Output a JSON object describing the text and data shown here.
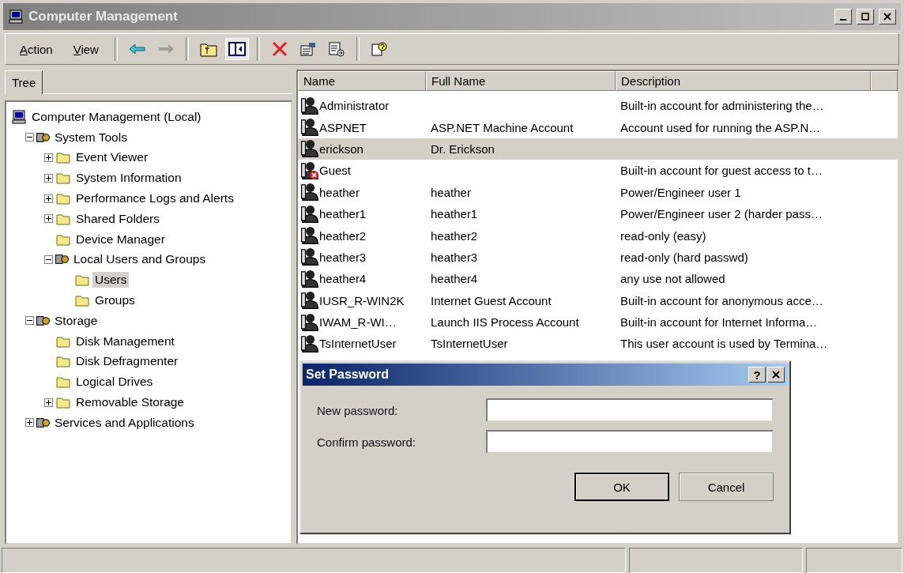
{
  "window": {
    "title": "Computer Management"
  },
  "menu": [
    {
      "label": "Action"
    },
    {
      "label": "View"
    }
  ],
  "tree_tab": {
    "label": "Tree",
    "selected": true
  },
  "tree": [
    {
      "label": "Computer Management (Local)",
      "selected": false,
      "children": [
        {
          "label": "System Tools",
          "selected": false,
          "expanded": true,
          "children": [
            {
              "label": "Event Viewer",
              "selected": false,
              "expanded": false
            },
            {
              "label": "System Information",
              "selected": false,
              "expanded": false
            },
            {
              "label": "Performance Logs and Alerts",
              "selected": false,
              "expanded": false
            },
            {
              "label": "Shared Folders",
              "selected": false,
              "expanded": false
            },
            {
              "label": "Device Manager",
              "selected": false
            },
            {
              "label": "Local Users and Groups",
              "selected": false,
              "expanded": true,
              "children": [
                {
                  "label": "Users",
                  "selected": true
                },
                {
                  "label": "Groups",
                  "selected": false
                }
              ]
            }
          ]
        },
        {
          "label": "Storage",
          "selected": false,
          "expanded": true,
          "children": [
            {
              "label": "Disk Management",
              "selected": false
            },
            {
              "label": "Disk Defragmenter",
              "selected": false
            },
            {
              "label": "Logical Drives",
              "selected": false
            },
            {
              "label": "Removable Storage",
              "selected": false,
              "expanded": false
            }
          ]
        },
        {
          "label": "Services and Applications",
          "selected": false,
          "expanded": false
        }
      ]
    }
  ],
  "table": {
    "columns": [
      "Name",
      "Full Name",
      "Description"
    ],
    "rows": [
      {
        "name": "Administrator",
        "full_name": "",
        "description": "Built-in account for administering the…",
        "selected": false,
        "disabled": false
      },
      {
        "name": "ASPNET",
        "full_name": "ASP.NET Machine Account",
        "description": "Account used for running the ASP.N…",
        "selected": false,
        "disabled": false
      },
      {
        "name": "erickson",
        "full_name": "Dr. Erickson",
        "description": "",
        "selected": true,
        "disabled": false
      },
      {
        "name": "Guest",
        "full_name": "",
        "description": "Built-in account for guest access to t…",
        "selected": false,
        "disabled": true
      },
      {
        "name": "heather",
        "full_name": "heather",
        "description": "Power/Engineer user 1",
        "selected": false,
        "disabled": false
      },
      {
        "name": "heather1",
        "full_name": "heather1",
        "description": "Power/Engineer user 2 (harder pass…",
        "selected": false,
        "disabled": false
      },
      {
        "name": "heather2",
        "full_name": "heather2",
        "description": "read-only (easy)",
        "selected": false,
        "disabled": false
      },
      {
        "name": "heather3",
        "full_name": "heather3",
        "description": "read-only (hard passwd)",
        "selected": false,
        "disabled": false
      },
      {
        "name": "heather4",
        "full_name": "heather4",
        "description": "any use not allowed",
        "selected": false,
        "disabled": false
      },
      {
        "name": "IUSR_R-WIN2K",
        "full_name": "Internet Guest Account",
        "description": "Built-in account for anonymous acce…",
        "selected": false,
        "disabled": false
      },
      {
        "name": "IWAM_R-WI…",
        "full_name": "Launch IIS Process Account",
        "description": "Built-in account for Internet Informa…",
        "selected": false,
        "disabled": false
      },
      {
        "name": "TsInternetUser",
        "full_name": "TsInternetUser",
        "description": "This user account is used by Termina…",
        "selected": false,
        "disabled": false
      }
    ]
  },
  "dialog": {
    "title": "Set Password",
    "help": "?",
    "fields": [
      {
        "label": "New password:"
      },
      {
        "label": "Confirm password:"
      }
    ],
    "buttons": [
      {
        "label": "OK",
        "default": true
      },
      {
        "label": "Cancel",
        "default": false
      }
    ]
  }
}
